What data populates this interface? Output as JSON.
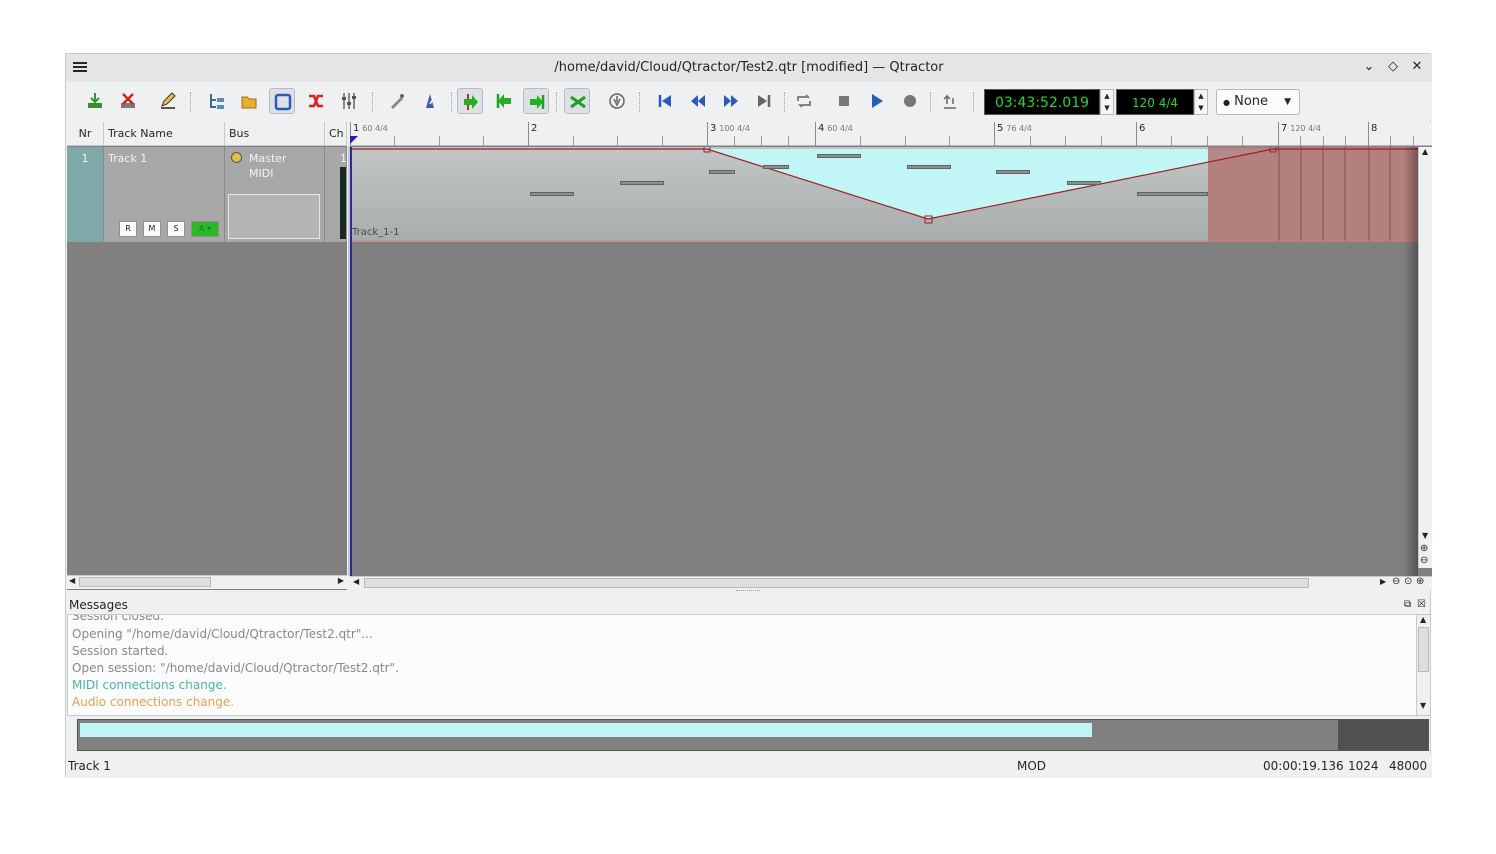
{
  "window": {
    "title": "/home/david/Cloud/Qtractor/Test2.qtr [modified] — Qtractor"
  },
  "toolbar": {
    "time_display": "03:43:52.019",
    "tempo_display": "120 4/4",
    "snap_value": "None"
  },
  "tracklist": {
    "headers": {
      "nr": "Nr",
      "name": "Track Name",
      "bus": "Bus",
      "ch": "Ch"
    },
    "tracks": [
      {
        "nr": "1",
        "name": "Track 1",
        "bus_line1": "Master",
        "bus_line2": "MIDI",
        "ch": "1",
        "buttons": {
          "record": "R",
          "mute": "M",
          "solo": "S",
          "auto": "A"
        }
      }
    ]
  },
  "ruler": {
    "bars": [
      {
        "n": "1",
        "tempo": "60 4/4"
      },
      {
        "n": "2",
        "tempo": ""
      },
      {
        "n": "3",
        "tempo": "100 4/4"
      },
      {
        "n": "4",
        "tempo": "60 4/4"
      },
      {
        "n": "5",
        "tempo": "76 4/4"
      },
      {
        "n": "6",
        "tempo": ""
      },
      {
        "n": "7",
        "tempo": "120 4/4"
      },
      {
        "n": "8",
        "tempo": ""
      }
    ]
  },
  "clip": {
    "label": "Track_1-1"
  },
  "messages": {
    "title": "Messages",
    "lines": [
      {
        "text": "Session closed.",
        "color": "#8c9596"
      },
      {
        "text": "Opening \"/home/david/Cloud/Qtractor/Test2.qtr\"...",
        "color": "#8c9596"
      },
      {
        "text": "Session started.",
        "color": "#8c9596"
      },
      {
        "text": "Open session: \"/home/david/Cloud/Qtractor/Test2.qtr\".",
        "color": "#8c9596"
      },
      {
        "text": "MIDI connections change.",
        "color": "#3daee9"
      },
      {
        "text": "Audio connections change.",
        "color": "#e5a050"
      }
    ]
  },
  "status": {
    "track": "Track 1",
    "mod": "MOD",
    "session_time": "00:00:19.136",
    "buffer_size": "1024",
    "sample_rate": "48000"
  },
  "colors": {
    "lcd_text": "#27d427",
    "clip_fill": "#c2f5f5",
    "automation_line": "#a02020",
    "loop_region": "#b47474"
  }
}
